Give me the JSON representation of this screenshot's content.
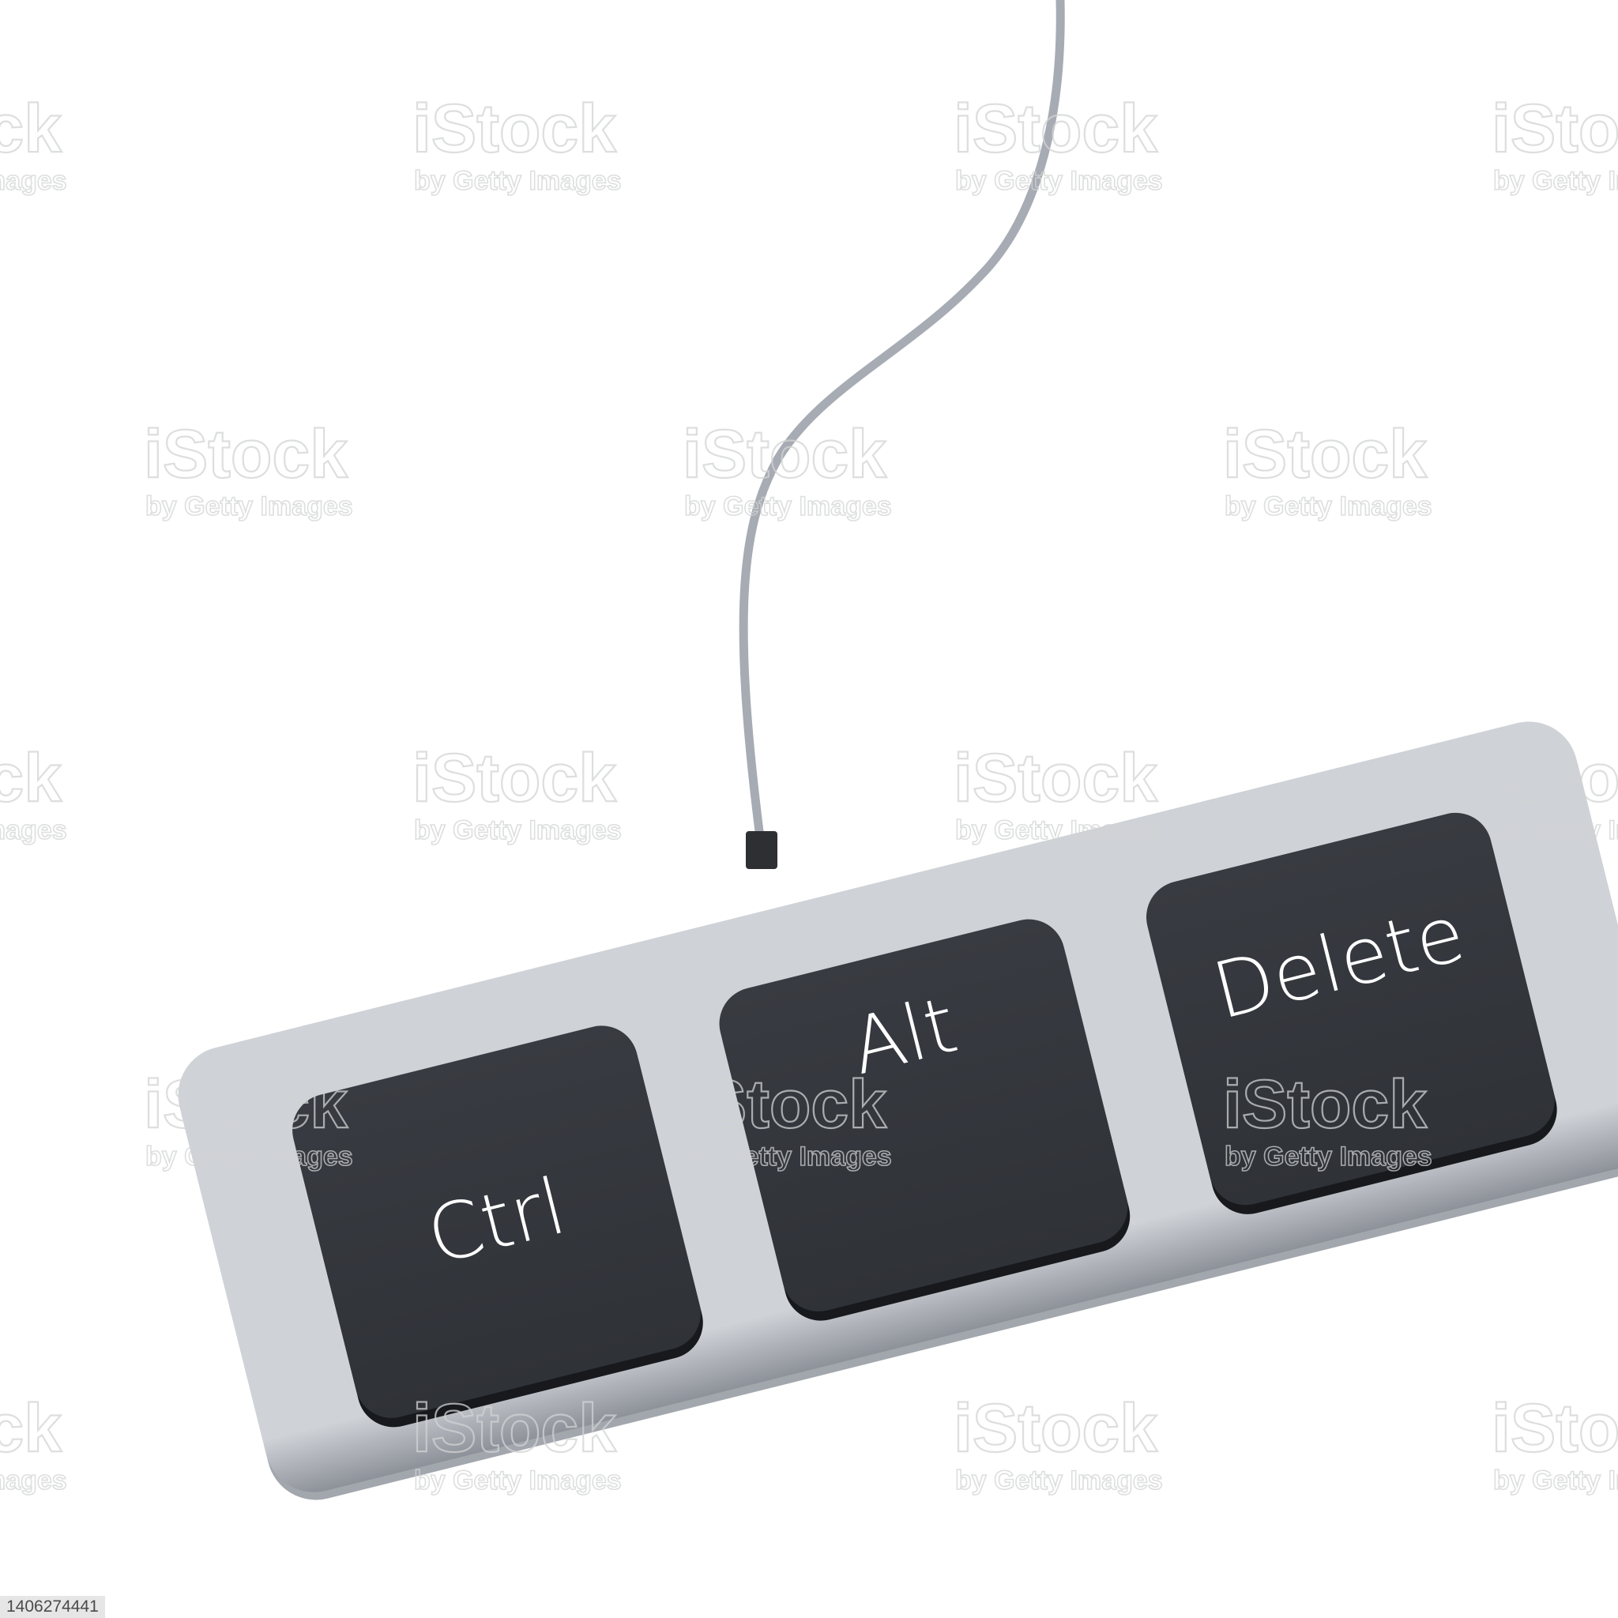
{
  "keys": [
    {
      "label": "Ctrl"
    },
    {
      "label": "Alt"
    },
    {
      "label": "Delete"
    }
  ],
  "watermark": {
    "brand": "iStock",
    "credit": "by Getty Images"
  },
  "image_id": "1406274441",
  "colors": {
    "key": "#33363c",
    "base": "#ced1d6",
    "cable": "#a7abb3",
    "connector": "#2d2f33",
    "background": "#ffffff"
  },
  "icons": {
    "keyboard": "keyboard-icon",
    "cable": "cable-icon"
  }
}
